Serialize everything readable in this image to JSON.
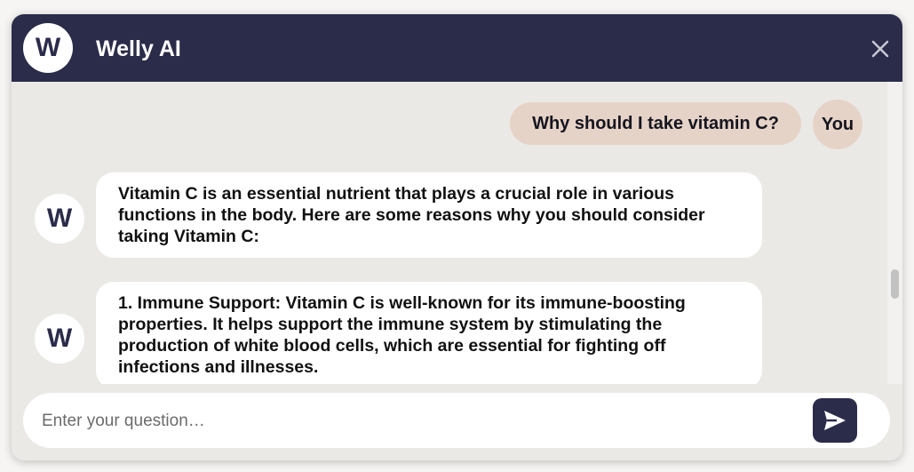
{
  "header": {
    "logo_letter": "W",
    "title": "Welly AI",
    "close_icon": "close-icon"
  },
  "colors": {
    "header_bg": "#2b2b4a",
    "user_bubble": "#e6d3c7",
    "bot_bubble": "#ffffff",
    "chat_bg": "#ebe9e6"
  },
  "messages": [
    {
      "sender": "user",
      "text": "Why should I take vitamin C?",
      "avatar": "You"
    },
    {
      "sender": "bot",
      "avatar": "W",
      "text": "Vitamin C is an essential nutrient that plays a crucial role in various functions in the body. Here are some reasons why you should consider taking Vitamin C:"
    },
    {
      "sender": "bot",
      "avatar": "W",
      "text": "1. Immune Support: Vitamin C is well-known for its immune-boosting properties. It helps support the immune system by stimulating the production of white blood cells, which are essential for fighting off infections and illnesses."
    }
  ],
  "composer": {
    "placeholder": "Enter your question…",
    "value": "",
    "send_icon": "send-icon"
  }
}
